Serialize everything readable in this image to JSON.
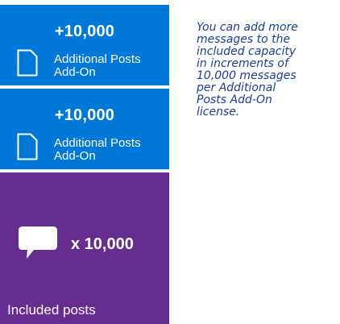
{
  "addon_tiles": [
    {
      "amount": "+10,000",
      "label_line1": "Additional Posts",
      "label_line2": "Add-On",
      "icon": "document-icon"
    },
    {
      "amount": "+10,000",
      "label_line1": "Additional Posts",
      "label_line2": "Add-On",
      "icon": "document-icon"
    }
  ],
  "included_tile": {
    "multiplier": "x 10,000",
    "label": "Included posts",
    "icon": "speech-bubble-icon"
  },
  "note_lines": [
    "You can add more",
    "messages to the",
    "included capacity",
    "in increments of",
    "10,000 messages",
    "per Additional",
    "Posts Add-On",
    "license."
  ],
  "colors": {
    "addon_tile": "#0078d7",
    "included_tile": "#662d91",
    "note_text": "#1f3c8f"
  }
}
